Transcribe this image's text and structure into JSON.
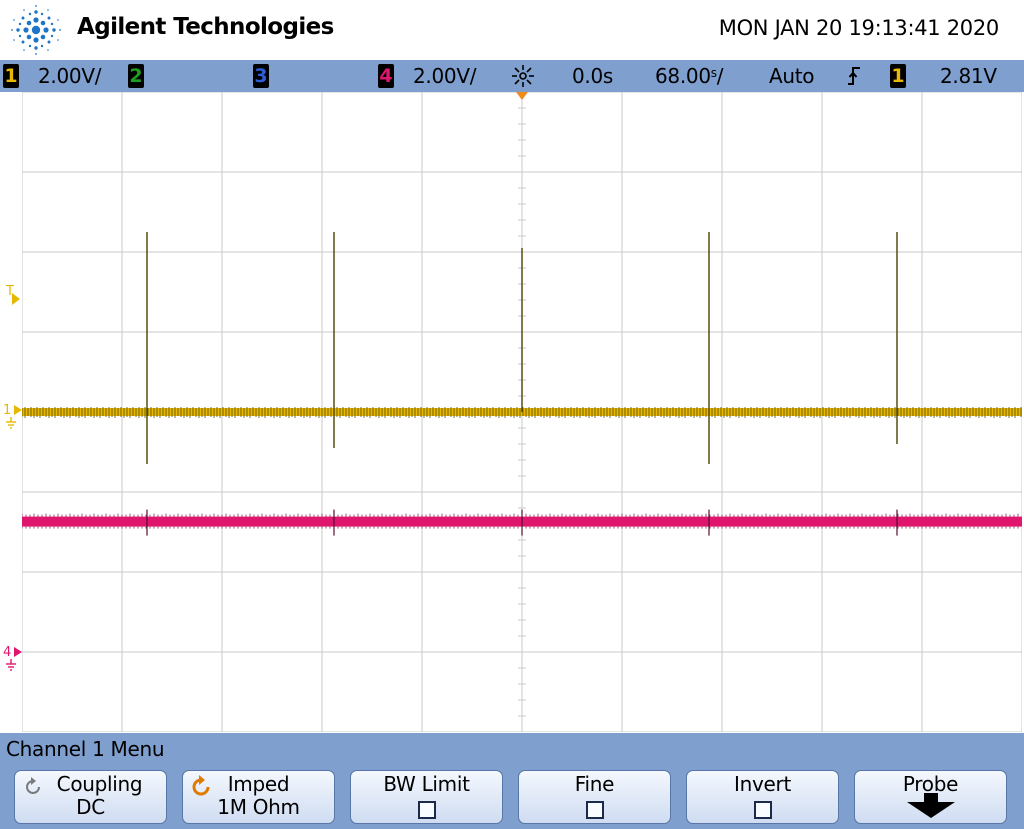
{
  "header": {
    "brand": "Agilent Technologies",
    "datetime": "MON JAN 20 19:13:41 2020"
  },
  "status_bar": {
    "ch1_chip": "1",
    "ch1_scale": "2.00V/",
    "ch2_chip": "2",
    "ch3_chip": "3",
    "ch4_chip": "4",
    "ch4_scale": "2.00V/",
    "time_delay": "0.0s",
    "time_scale": "68.00",
    "time_scale_unit": "s",
    "trigger_mode": "Auto",
    "trigger_source_chip": "1",
    "trigger_level": "2.81V"
  },
  "markers": {
    "trigger_level": "T",
    "ch1_ground": "1",
    "ch4_ground": "4"
  },
  "menu": {
    "title": "Channel 1  Menu",
    "softkeys": [
      {
        "label": "Coupling",
        "value": "DC"
      },
      {
        "label": "Imped",
        "value": "1M Ohm"
      },
      {
        "label": "BW Limit",
        "state": "off"
      },
      {
        "label": "Fine",
        "state": "off"
      },
      {
        "label": "Invert",
        "state": "off"
      },
      {
        "label": "Probe"
      }
    ]
  },
  "colors": {
    "ch1": "#e6b800",
    "ch2": "#1e9e1e",
    "ch3": "#2f5fd6",
    "ch4": "#e0156e",
    "trigger": "#f08a1c",
    "grid": "#c8c8c8",
    "bar": "#7f9fcf"
  },
  "waveforms": {
    "ch1_spike_times": [
      -3.75,
      -1.88,
      0.0,
      1.87,
      3.75
    ],
    "ch1_spike_tops_div": [
      2.25,
      2.25,
      2.05,
      2.25,
      2.25
    ],
    "ch1_spike_bottoms_div": [
      -0.65,
      -0.45,
      0,
      -0.65,
      -0.4
    ],
    "ch4_spike_times": [
      -3.75,
      -1.88,
      0.0,
      1.87,
      3.75
    ],
    "trigger_level_div": 1.39,
    "ch1_offset_div": 0.0,
    "ch4_offset_div": -1.37
  }
}
